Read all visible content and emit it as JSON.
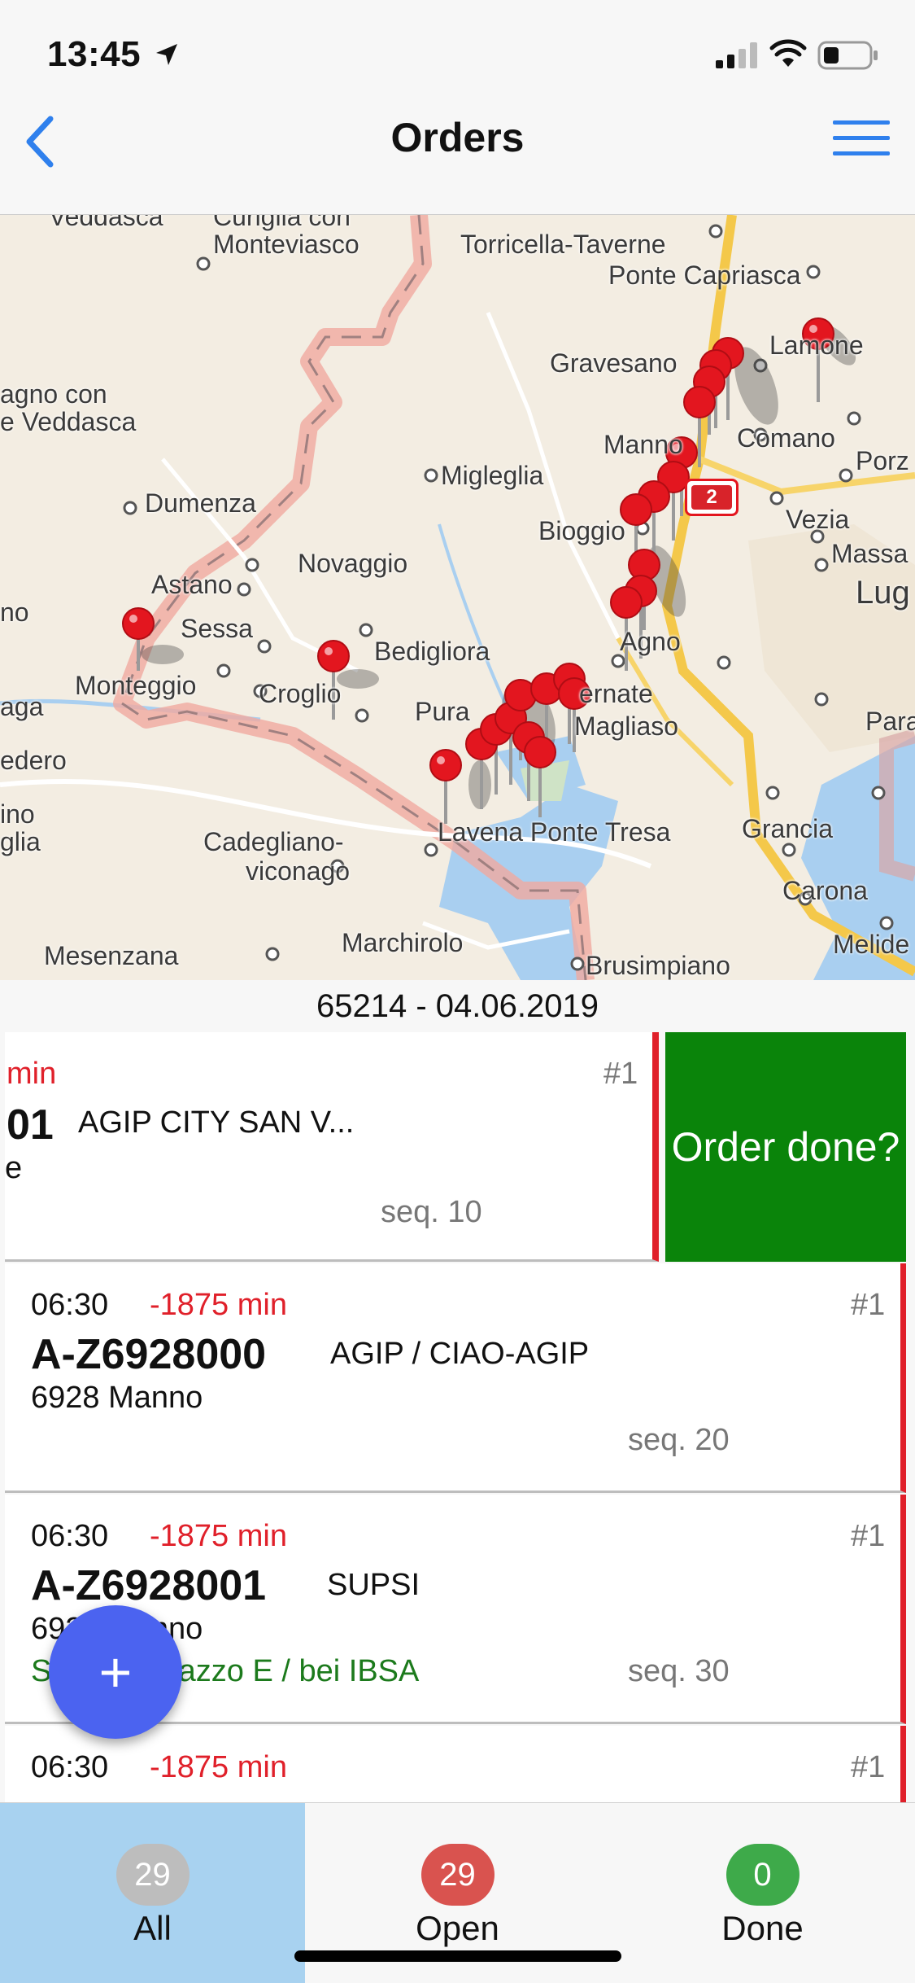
{
  "status_bar": {
    "time": "13:45"
  },
  "nav": {
    "title": "Orders"
  },
  "map": {
    "places": [
      "Veddasca",
      "Curiglia con",
      "Monteviasco",
      "Torricella-Taverne",
      "Ponte Capriasca",
      "Lamone",
      "Gravesano",
      "agno con",
      "e Veddasca",
      "Manno",
      "Comano",
      "Porz",
      "Migleglia",
      "Dumenza",
      "Bioggio",
      "Vezia",
      "Massa",
      "Novaggio",
      "Astano",
      "Lug",
      "Sessa",
      "Bedigliora",
      "Agno",
      "no",
      "Monteggio",
      "Croglio",
      "Pura",
      "ernate",
      "Magliaso",
      "Paradi",
      "aga",
      "edero",
      "ino",
      "glia",
      "Cadegliano-",
      "viconago",
      "Lavena Ponte Tresa",
      "Grancia",
      "Carona",
      "Melide",
      "Mesenzana",
      "Marchirolo",
      "Brusimpiano"
    ],
    "cluster_count": "2",
    "pin_color": "#e3161f"
  },
  "route": {
    "header": "65214 - 04.06.2019"
  },
  "orders": [
    {
      "time": "",
      "delay": "min",
      "num": "#1",
      "code": "01",
      "name": "AGIP CITY SAN V...",
      "addr": "e",
      "note": "",
      "seq": "seq. 10",
      "action": "Order done?"
    },
    {
      "time": "06:30",
      "delay": "-1875 min",
      "num": "#1",
      "code": "A-Z6928000",
      "name": "AGIP / CIAO-AGIP",
      "addr": "6928 Manno",
      "note": "",
      "seq": "seq. 20"
    },
    {
      "time": "06:30",
      "delay": "-1875 min",
      "num": "#1",
      "code": "A-Z6928001",
      "name": "SUPSI",
      "addr": "6928 Manno",
      "note": "Stabile Palazzo E / bei IBSA",
      "seq": "seq. 30"
    },
    {
      "time": "06:30",
      "delay": "-1875 min",
      "num": "#1",
      "code": "",
      "name": "",
      "addr": "",
      "note": "",
      "seq": ""
    }
  ],
  "fab": {
    "label": "+"
  },
  "tabs": [
    {
      "count": "29",
      "label": "All",
      "badge_color": "#bdbdbd"
    },
    {
      "count": "29",
      "label": "Open",
      "badge_color": "#d9534f"
    },
    {
      "count": "0",
      "label": "Done",
      "badge_color": "#3eaa4a"
    }
  ],
  "colors": {
    "accent": "#2f80ed",
    "late": "#e0202a",
    "done_action": "#0a840a",
    "fab": "#4b63f0",
    "active_tab": "#a8d2f0"
  }
}
